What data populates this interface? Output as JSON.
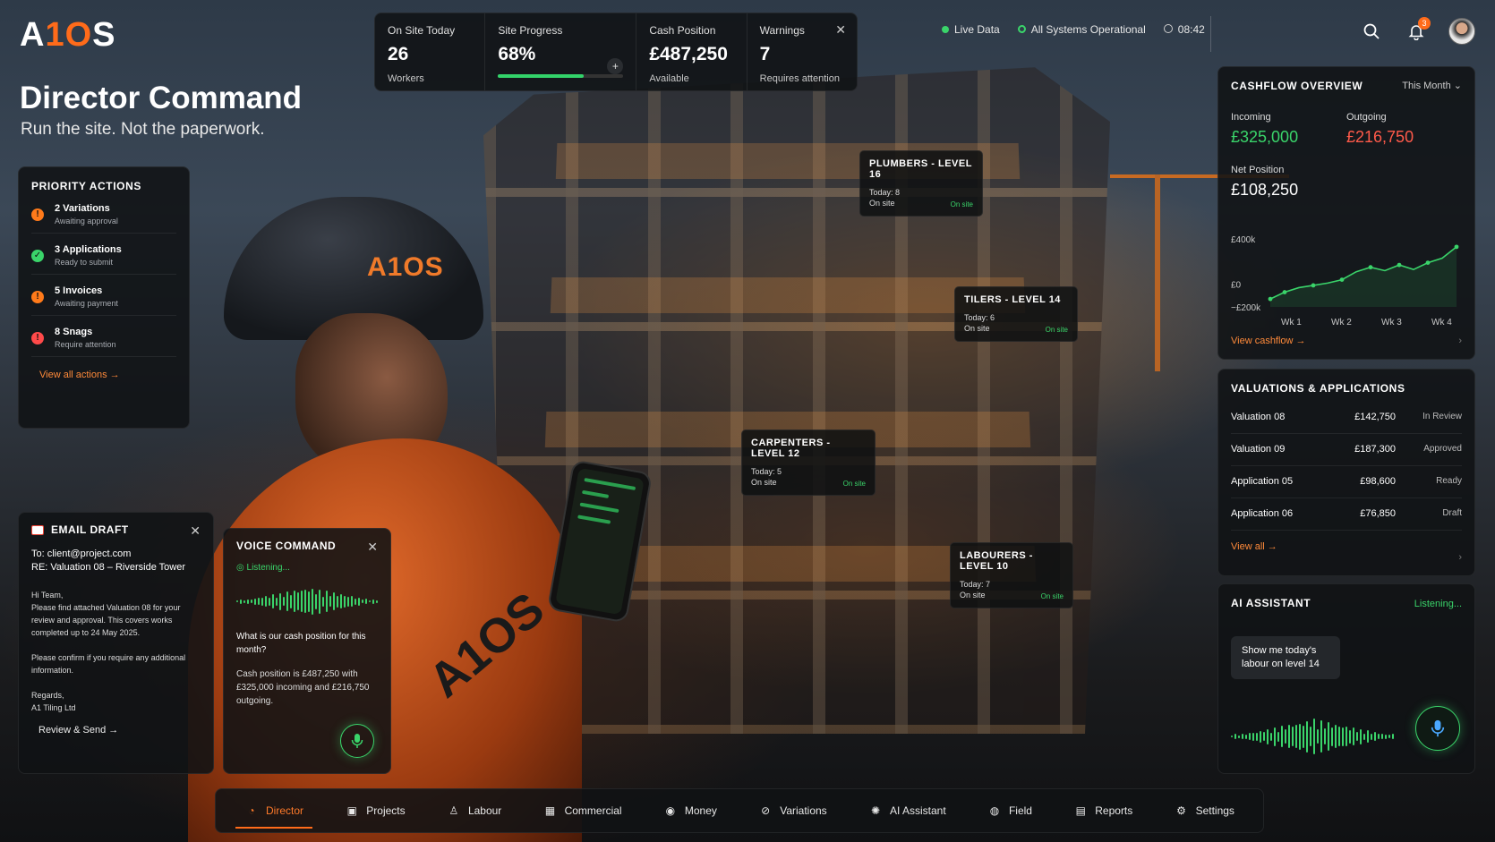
{
  "brand": {
    "name_prefix": "A",
    "name_mid": "1",
    "name_o": "O",
    "name_suffix": "S"
  },
  "hero": {
    "title": "Director Command",
    "subtitle": "Run the site. Not the paperwork."
  },
  "stats": [
    {
      "label": "On Site Today",
      "value": "26",
      "sub": "Workers"
    },
    {
      "label": "Site Progress",
      "value": "68%",
      "progress": 0.68
    },
    {
      "label": "Cash Position",
      "value": "£487,250",
      "sub": "Available"
    },
    {
      "label": "Warnings",
      "value": "7",
      "sub": "Requires attention"
    }
  ],
  "status": {
    "live": "Live Data",
    "systems": "All Systems Operational",
    "time": "08:42"
  },
  "notifications": {
    "count": "3"
  },
  "priority": {
    "title": "PRIORITY ACTIONS",
    "items": [
      {
        "title": "2 Variations",
        "sub": "Awaiting approval",
        "color": "#ff7a1a",
        "icon": "!"
      },
      {
        "title": "3 Applications",
        "sub": "Ready to submit",
        "color": "#3ad46a",
        "icon": "✓"
      },
      {
        "title": "5 Invoices",
        "sub": "Awaiting payment",
        "color": "#ff7a1a",
        "icon": "!"
      },
      {
        "title": "8 Snags",
        "sub": "Require attention",
        "color": "#ff4a4a",
        "icon": "!"
      }
    ],
    "link": "View all actions →"
  },
  "tags": [
    {
      "title": "PLUMBERS - LEVEL 16",
      "today": "Today: 8",
      "site": "On site",
      "status": "On site"
    },
    {
      "title": "TILERS - LEVEL 14",
      "today": "Today: 6",
      "site": "On site",
      "status": "On site"
    },
    {
      "title": "CARPENTERS - LEVEL 12",
      "today": "Today: 5",
      "site": "On site",
      "status": "On site"
    },
    {
      "title": "LABOURERS - LEVEL 10",
      "today": "Today: 7",
      "site": "On site",
      "status": "On site"
    }
  ],
  "email": {
    "title": "EMAIL DRAFT",
    "to": "To: client@project.com",
    "re": "RE: Valuation 08 – Riverside Tower",
    "body": "Hi Team,\nPlease find attached Valuation 08 for your review and approval. This covers works completed up to 24 May 2025.\n\nPlease confirm if you require any additional information.\n\nRegards,\nA1 Tiling Ltd",
    "action": "Review & Send →"
  },
  "voice": {
    "title": "VOICE COMMAND",
    "status": "Listening...",
    "question": "What is our cash position for this month?",
    "answer": "Cash position is £487,250 with £325,000 incoming and £216,750 outgoing."
  },
  "cashflow": {
    "title": "CASHFLOW OVERVIEW",
    "period": "This Month",
    "incoming_label": "Incoming",
    "incoming": "£325,000",
    "outgoing_label": "Outgoing",
    "outgoing": "£216,750",
    "net_label": "Net Position",
    "net": "£108,250",
    "link": "View cashflow →"
  },
  "chart_data": {
    "type": "line",
    "categories": [
      "Wk 1",
      "Wk 2",
      "Wk 3",
      "Wk 4"
    ],
    "y_tick_labels": [
      "£400k",
      "£0",
      "−£200k"
    ],
    "ylim": [
      -200,
      400
    ],
    "series": [
      {
        "values": [
          -130,
          -70,
          -30,
          -10,
          10,
          40,
          110,
          150,
          120,
          170,
          130,
          190,
          230,
          330
        ]
      }
    ],
    "color": "#3ad46a"
  },
  "valuations": {
    "title": "VALUATIONS & APPLICATIONS",
    "rows": [
      {
        "name": "Valuation 08",
        "amount": "£142,750",
        "status": "In Review"
      },
      {
        "name": "Valuation 09",
        "amount": "£187,300",
        "status": "Approved"
      },
      {
        "name": "Application 05",
        "amount": "£98,600",
        "status": "Ready"
      },
      {
        "name": "Application 06",
        "amount": "£76,850",
        "status": "Draft"
      }
    ],
    "link": "View all →"
  },
  "ai": {
    "title": "AI ASSISTANT",
    "status": "Listening...",
    "message": "Show me today's labour on level 14"
  },
  "nav": [
    {
      "label": "Director",
      "icon": "dashboard-icon",
      "active": true
    },
    {
      "label": "Projects",
      "icon": "projects-icon"
    },
    {
      "label": "Labour",
      "icon": "labour-icon"
    },
    {
      "label": "Commercial",
      "icon": "commercial-icon"
    },
    {
      "label": "Money",
      "icon": "money-icon"
    },
    {
      "label": "Variations",
      "icon": "variations-icon"
    },
    {
      "label": "AI Assistant",
      "icon": "ai-icon"
    },
    {
      "label": "Field",
      "icon": "field-icon"
    },
    {
      "label": "Reports",
      "icon": "reports-icon"
    },
    {
      "label": "Settings",
      "icon": "settings-icon"
    }
  ]
}
